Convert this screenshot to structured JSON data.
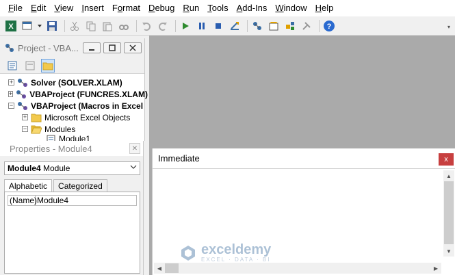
{
  "menu": [
    {
      "label": "File",
      "accel": "F"
    },
    {
      "label": "Edit",
      "accel": "E"
    },
    {
      "label": "View",
      "accel": "V"
    },
    {
      "label": "Insert",
      "accel": "I"
    },
    {
      "label": "Format",
      "accel": "o"
    },
    {
      "label": "Debug",
      "accel": "D"
    },
    {
      "label": "Run",
      "accel": "R"
    },
    {
      "label": "Tools",
      "accel": "T"
    },
    {
      "label": "Add-Ins",
      "accel": "A"
    },
    {
      "label": "Window",
      "accel": "W"
    },
    {
      "label": "Help",
      "accel": "H"
    }
  ],
  "project": {
    "title": "Project - VBA...",
    "tree": [
      {
        "label": "Solver (SOLVER.XLAM)",
        "bold": true
      },
      {
        "label": "VBAProject (FUNCRES.XLAM)",
        "bold": true
      },
      {
        "label": "VBAProject (Macros in Excel",
        "bold": true
      },
      {
        "label": "Microsoft Excel Objects",
        "bold": false
      },
      {
        "label": "Modules",
        "bold": false
      },
      {
        "label": "Module1",
        "bold": false
      }
    ]
  },
  "properties": {
    "title": "Properties - Module4",
    "object_name": "Module4",
    "object_type": "Module",
    "tabs": [
      "Alphabetic",
      "Categorized"
    ],
    "rows": [
      {
        "key": "(Name)",
        "value": "Module4"
      }
    ]
  },
  "immediate": {
    "title": "Immediate",
    "close_label": "x"
  },
  "watermark": {
    "name": "exceldemy",
    "tagline": "EXCEL · DATA · BI"
  },
  "colors": {
    "workspace": "#aaaaaa",
    "close_button": "#c73f3f",
    "accent": "#6c9ed8"
  }
}
